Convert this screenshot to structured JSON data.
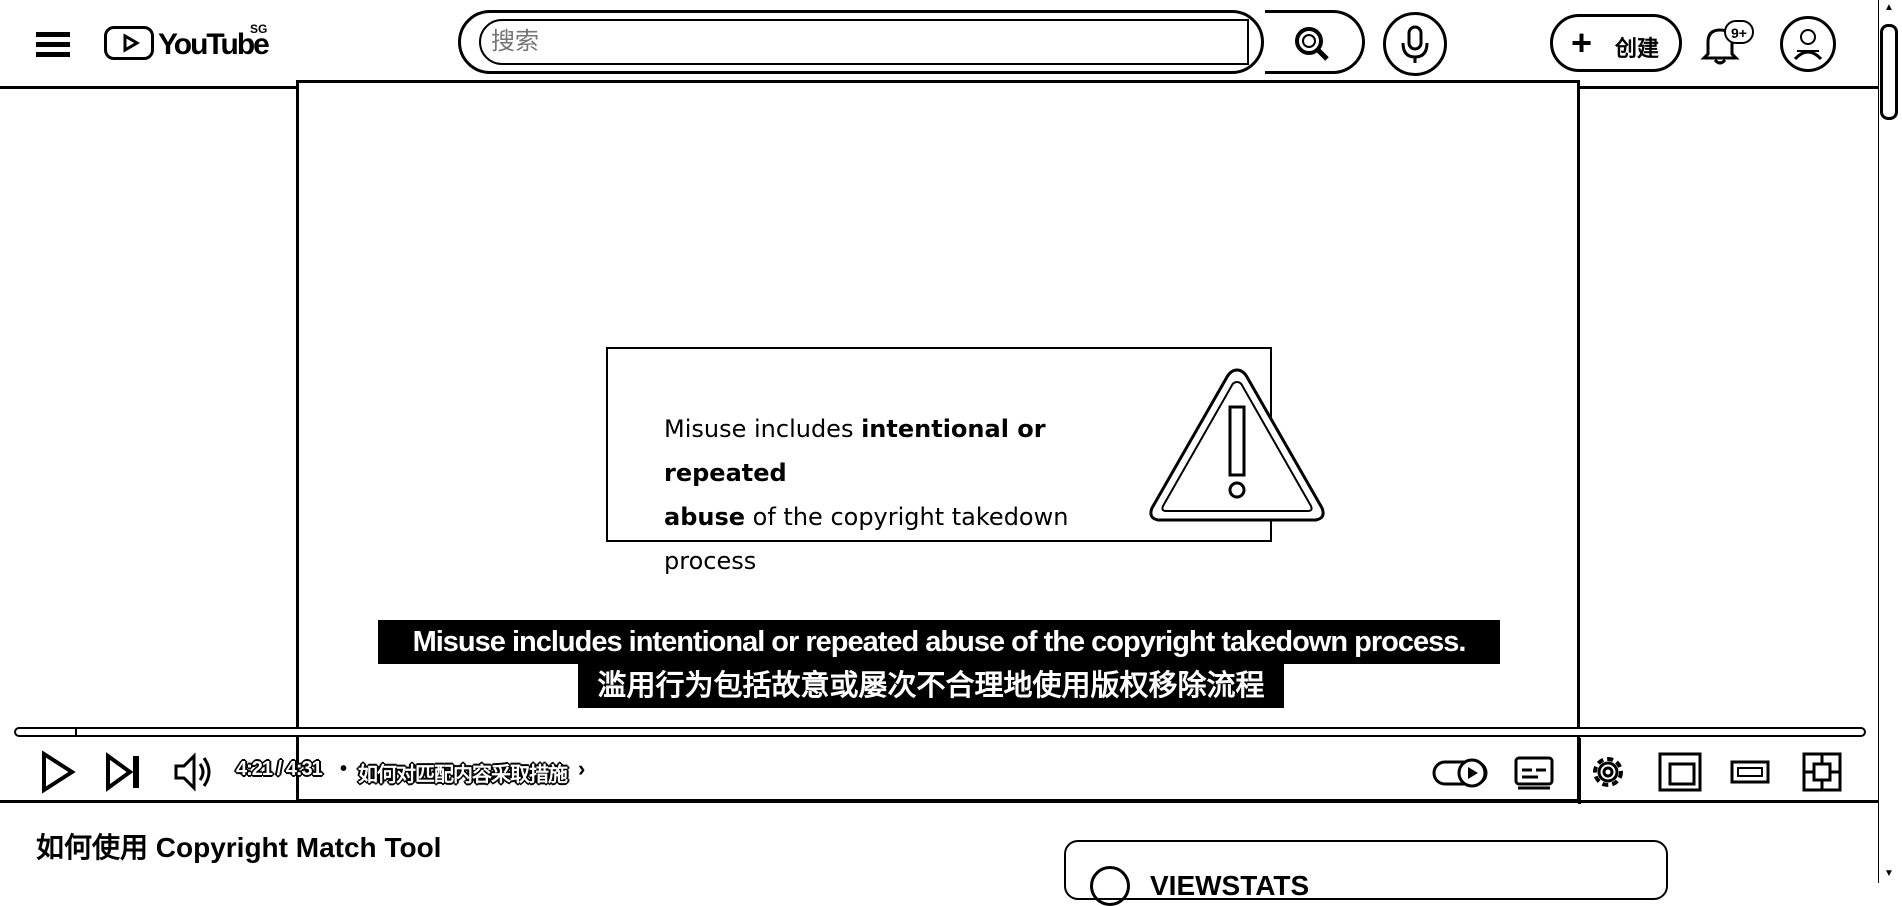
{
  "header": {
    "logo_text": "YouTube",
    "country_code": "SG",
    "search_placeholder": "搜索",
    "create_label": "创建",
    "notification_count": "9+"
  },
  "player": {
    "slide": {
      "line1_normal": "Misuse includes ",
      "line1_bold": "intentional or repeated",
      "line2_bold": "abuse",
      "line2_normal": " of the copyright takedown process"
    },
    "captions": {
      "english": "Misuse includes intentional or repeated abuse of the copyright takedown process.",
      "chinese": "滥用行为包括故意或屡次不合理地使用版权移除流程"
    },
    "progress_fraction": 0.033,
    "time_display": "4:21 / 4:31",
    "chapter_separator": "•",
    "chapter_title": "如何对匹配内容采取措施",
    "chapter_arrow": "›"
  },
  "video": {
    "title": "如何使用 Copyright Match Tool"
  },
  "side_card": {
    "label": "VIEWSTATS"
  },
  "icons": {
    "menu": "menu-icon",
    "search": "search-icon",
    "mic": "microphone-icon",
    "notifications": "bell-icon",
    "play": "play-icon",
    "next": "next-icon",
    "volume": "volume-icon",
    "autoplay": "autoplay-toggle-icon",
    "subtitles": "subtitles-icon",
    "settings": "gear-icon",
    "miniplayer": "miniplayer-icon",
    "theater": "theater-mode-icon",
    "fullscreen": "fullscreen-icon",
    "warning": "warning-triangle-icon"
  }
}
